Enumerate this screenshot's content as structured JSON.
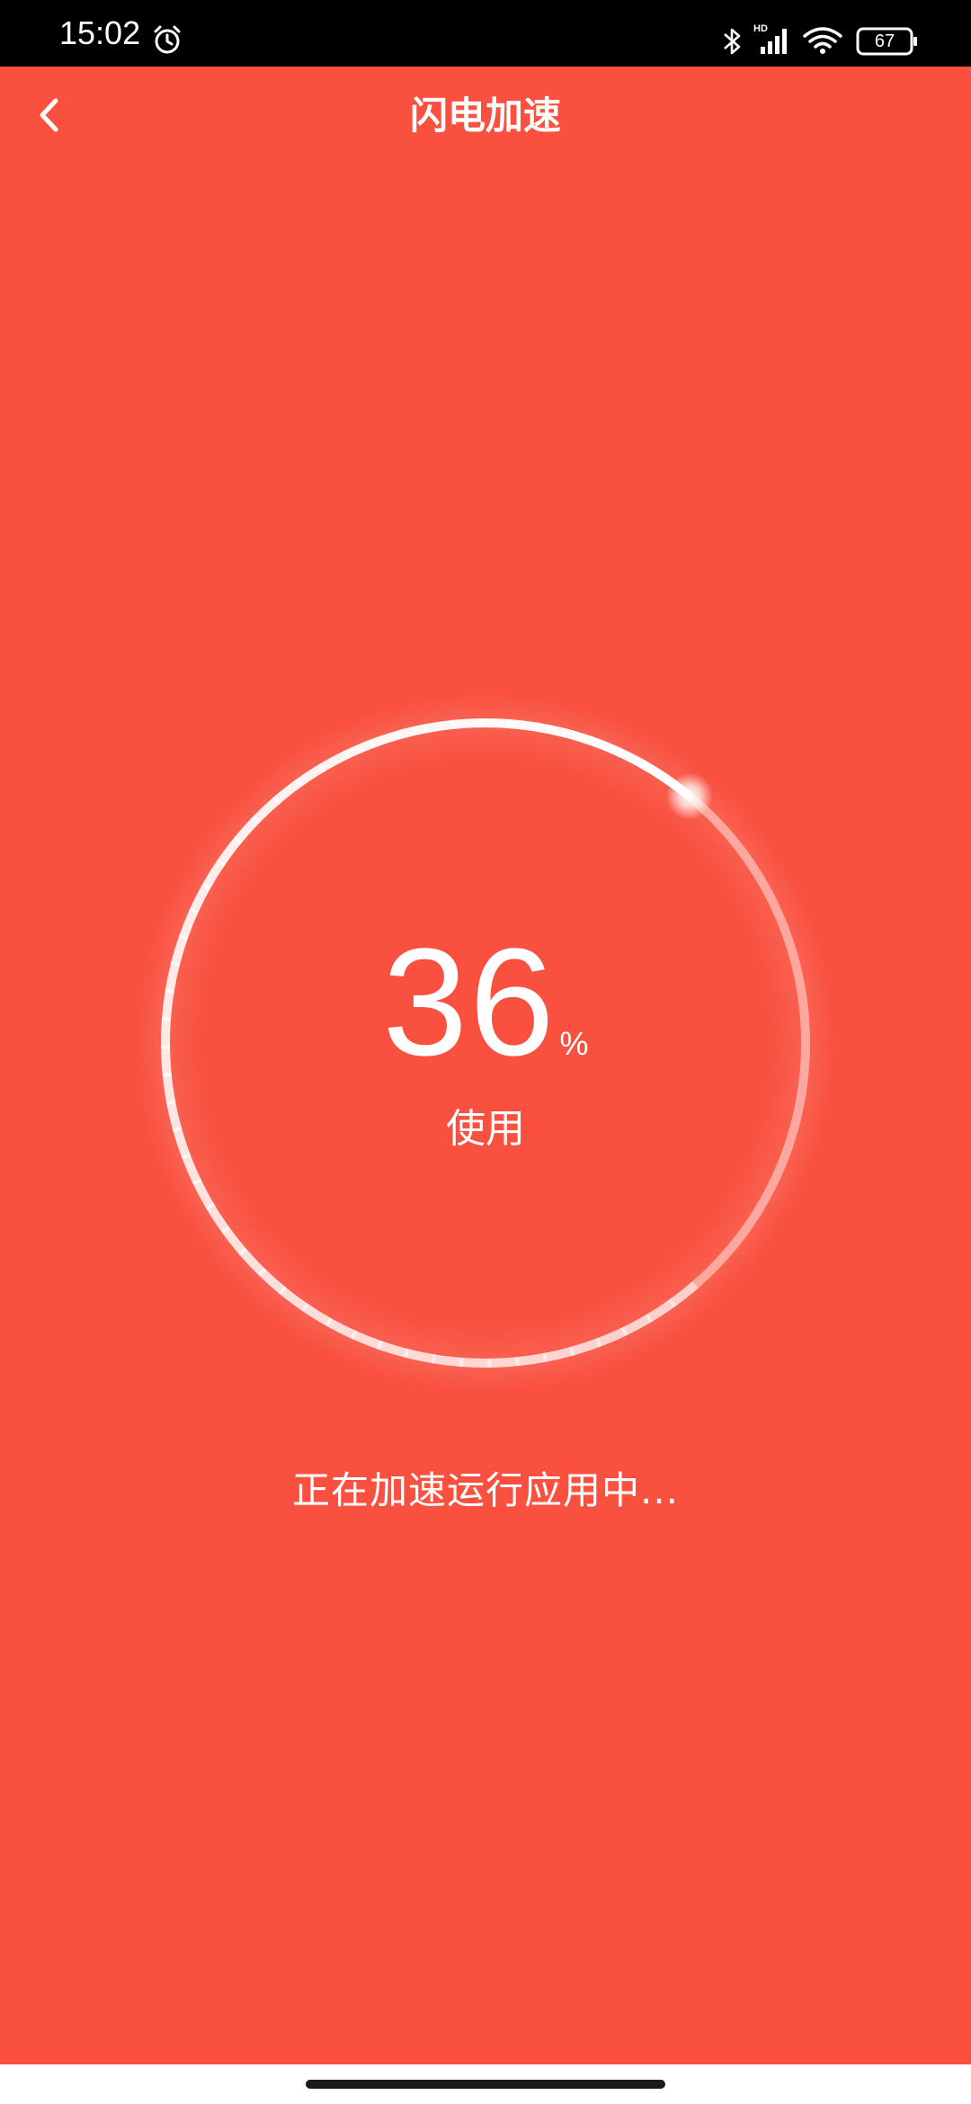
{
  "status_bar": {
    "time": "15:02",
    "battery": "67",
    "icons": [
      "alarm-icon",
      "bluetooth-icon",
      "hd-signal-icon",
      "wifi-icon",
      "battery-icon"
    ]
  },
  "header": {
    "title": "闪电加速",
    "back_icon": "chevron-left-icon"
  },
  "progress": {
    "value": "36",
    "unit": "%",
    "label": "使用",
    "fraction": 0.36
  },
  "message": "正在加速运行应用中...",
  "colors": {
    "background": "#f9503f",
    "ring": "#ffffff",
    "status_bar": "#000000"
  }
}
